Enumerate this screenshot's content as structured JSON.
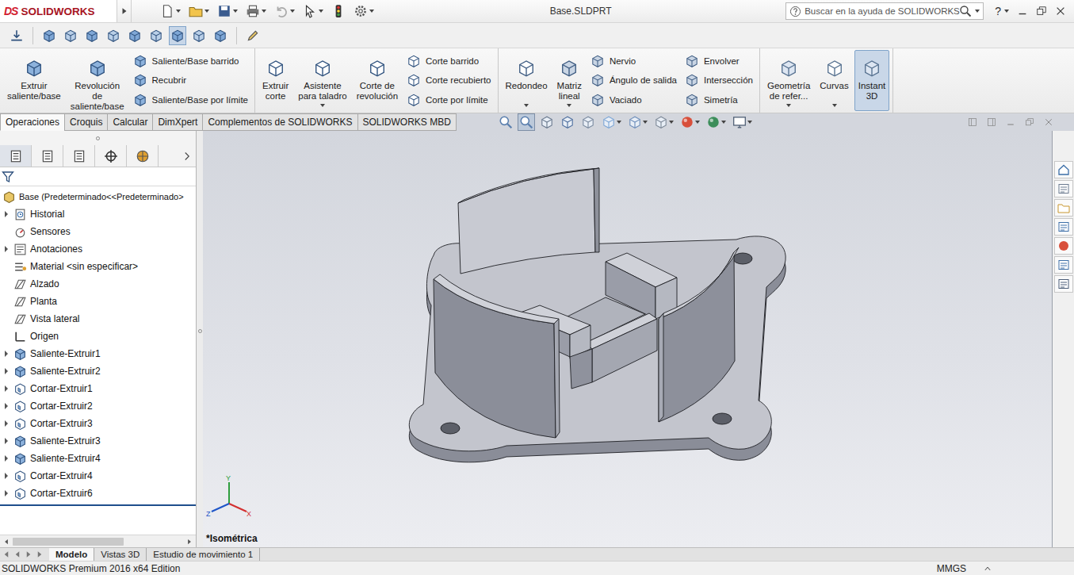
{
  "window": {
    "title": "Base.SLDPRT",
    "logo": {
      "mark": "DS",
      "name": "SOLIDWORKS"
    }
  },
  "search": {
    "placeholder": "Buscar en la ayuda de SOLIDWORKS"
  },
  "help": "?",
  "command_groups": [
    {
      "items": [
        {
          "kind": "large",
          "lines": [
            "Extruir",
            "saliente/base"
          ],
          "menu": false,
          "selected": false
        },
        {
          "kind": "large",
          "lines": [
            "Revolución",
            "de",
            "saliente/base"
          ],
          "menu": false,
          "selected": false
        },
        {
          "kind": "column",
          "entries": [
            {
              "label": "Saliente/Base barrido"
            },
            {
              "label": "Recubrir"
            },
            {
              "label": "Saliente/Base por límite"
            }
          ]
        }
      ]
    },
    {
      "items": [
        {
          "kind": "large",
          "lines": [
            "Extruir",
            "corte"
          ],
          "menu": false,
          "selected": false
        },
        {
          "kind": "large",
          "lines": [
            "Asistente",
            "para taladro"
          ],
          "menu": true,
          "selected": false
        },
        {
          "kind": "large",
          "lines": [
            "Corte de",
            "revolución"
          ],
          "menu": false,
          "selected": false
        },
        {
          "kind": "column",
          "entries": [
            {
              "label": "Corte barrido"
            },
            {
              "label": "Corte recubierto"
            },
            {
              "label": "Corte por límite"
            }
          ]
        }
      ]
    },
    {
      "items": [
        {
          "kind": "large",
          "lines": [
            "Redondeo"
          ],
          "menu": true,
          "selected": false
        },
        {
          "kind": "large",
          "lines": [
            "Matriz",
            "lineal"
          ],
          "menu": true,
          "selected": false
        },
        {
          "kind": "column",
          "entries": [
            {
              "label": "Nervio"
            },
            {
              "label": "Ángulo de salida"
            },
            {
              "label": "Vaciado"
            }
          ]
        },
        {
          "kind": "column",
          "entries": [
            {
              "label": "Envolver"
            },
            {
              "label": "Intersección"
            },
            {
              "label": "Simetría"
            }
          ]
        }
      ]
    },
    {
      "items": [
        {
          "kind": "large",
          "lines": [
            "Geometría",
            "de refer..."
          ],
          "menu": true,
          "selected": false
        },
        {
          "kind": "large",
          "lines": [
            "Curvas"
          ],
          "menu": true,
          "selected": false
        },
        {
          "kind": "large",
          "lines": [
            "Instant",
            "3D"
          ],
          "menu": false,
          "selected": true
        }
      ]
    }
  ],
  "feature_tabs": [
    {
      "label": "Operaciones",
      "selected": true
    },
    {
      "label": "Croquis",
      "selected": false
    },
    {
      "label": "Calcular",
      "selected": false
    },
    {
      "label": "DimXpert",
      "selected": false
    },
    {
      "label": "Complementos de SOLIDWORKS",
      "selected": false
    },
    {
      "label": "SOLIDWORKS MBD",
      "selected": false
    }
  ],
  "tree": {
    "root": "Base  (Predeterminado<<Predeterminado>",
    "items": [
      {
        "label": "Historial",
        "kind": "history",
        "expandable": true
      },
      {
        "label": "Sensores",
        "kind": "sensor",
        "expandable": false
      },
      {
        "label": "Anotaciones",
        "kind": "annotation",
        "expandable": true
      },
      {
        "label": "Material <sin especificar>",
        "kind": "material",
        "expandable": false
      },
      {
        "label": "Alzado",
        "kind": "plane",
        "expandable": false
      },
      {
        "label": "Planta",
        "kind": "plane",
        "expandable": false
      },
      {
        "label": "Vista lateral",
        "kind": "plane",
        "expandable": false
      },
      {
        "label": "Origen",
        "kind": "origin",
        "expandable": false
      },
      {
        "label": "Saliente-Extruir1",
        "kind": "boss",
        "expandable": true
      },
      {
        "label": "Saliente-Extruir2",
        "kind": "boss",
        "expandable": true
      },
      {
        "label": "Cortar-Extruir1",
        "kind": "cut",
        "expandable": true
      },
      {
        "label": "Cortar-Extruir2",
        "kind": "cut",
        "expandable": true
      },
      {
        "label": "Cortar-Extruir3",
        "kind": "cut",
        "expandable": true
      },
      {
        "label": "Saliente-Extruir3",
        "kind": "boss",
        "expandable": true
      },
      {
        "label": "Saliente-Extruir4",
        "kind": "boss",
        "expandable": true
      },
      {
        "label": "Cortar-Extruir4",
        "kind": "cut",
        "expandable": true
      },
      {
        "label": "Cortar-Extruir6",
        "kind": "cut",
        "expandable": true
      }
    ]
  },
  "viewport": {
    "view_label": "*Isométrica",
    "triad": {
      "x": "X",
      "y": "Y",
      "z": "Z"
    }
  },
  "bottom_tabs": [
    {
      "label": "Modelo",
      "selected": true
    },
    {
      "label": "Vistas 3D",
      "selected": false
    },
    {
      "label": "Estudio de movimiento 1",
      "selected": false
    }
  ],
  "status_bar": {
    "edition": "SOLIDWORKS Premium 2016 x64 Edition",
    "units": "MMGS"
  }
}
